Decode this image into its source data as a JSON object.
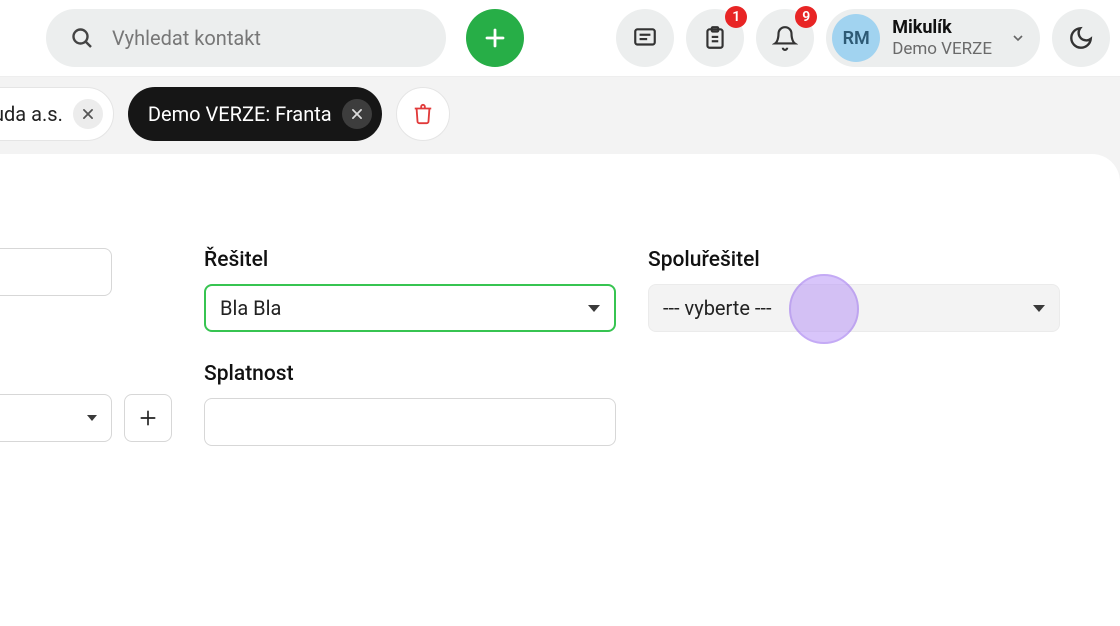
{
  "header": {
    "search_placeholder": "Vyhledat kontakt",
    "badges": {
      "clipboard": "1",
      "bell": "9"
    },
    "user": {
      "initials": "RM",
      "name": "Mikulík",
      "sub": "Demo VERZE"
    }
  },
  "tabs": [
    {
      "label": "uda a.s.",
      "active": false
    },
    {
      "label": "Demo VERZE: Franta",
      "active": true
    }
  ],
  "form": {
    "resitel": {
      "label": "Řešitel",
      "value": "Bla Bla"
    },
    "spoluresitel": {
      "label": "Spoluřešitel",
      "value": "--- vyberte ---"
    },
    "splatnost": {
      "label": "Splatnost",
      "value": ""
    }
  }
}
